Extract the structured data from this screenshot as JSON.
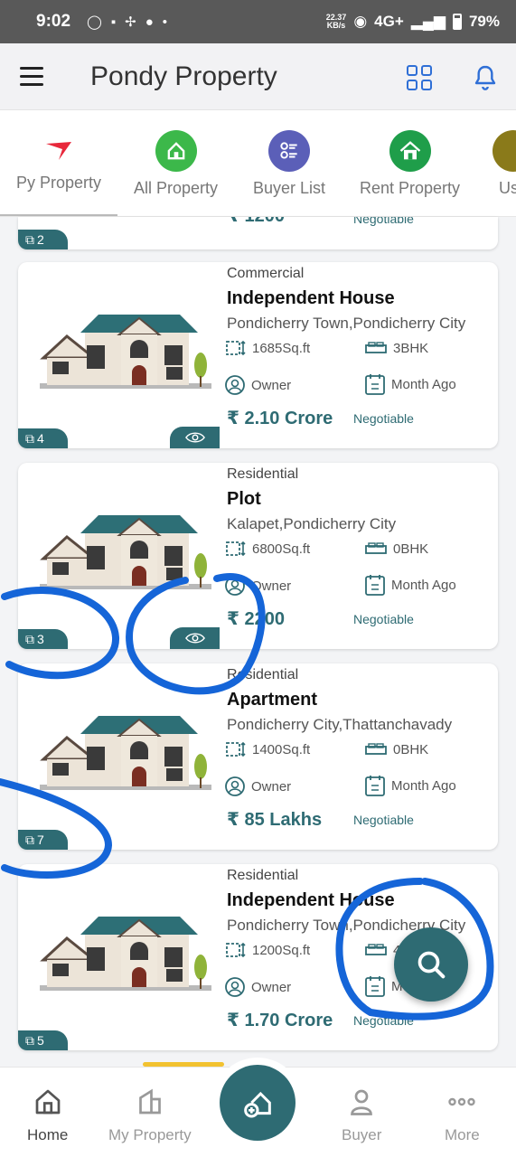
{
  "status_bar": {
    "time": "9:02",
    "speed_value": "22.37",
    "speed_unit": "KB/s",
    "network": "4G+",
    "battery": "79%"
  },
  "app_bar": {
    "title": "Pondy Property",
    "menu_icon": "hamburger-menu-icon",
    "grid_icon": "grid-icon",
    "bell_icon": "bell-icon",
    "accent": "#2f6fd6"
  },
  "categories": [
    {
      "label": "Py Property",
      "icon": "logo-icon",
      "active": true
    },
    {
      "label": "All Property",
      "icon": "house-hand-icon",
      "color": "#3cb84a"
    },
    {
      "label": "Buyer List",
      "icon": "list-icon",
      "color": "#5b5fb8"
    },
    {
      "label": "Rent Property",
      "icon": "house-icon",
      "color": "#1f9e4a"
    },
    {
      "label": "Use",
      "icon": "partial-icon",
      "color": "#8a7a1a"
    }
  ],
  "partial_card": {
    "price": "₹ 1200",
    "negotiable": "Negotiable",
    "photos": "2"
  },
  "listings": [
    {
      "type": "Commercial",
      "title": "Independent House",
      "location": "Pondicherry Town,Pondicherry City",
      "area": "1685Sq.ft",
      "bhk": "3BHK",
      "posted_by": "Owner",
      "posted": "Month Ago",
      "price": "₹ 2.10 Crore",
      "negotiable": "Negotiable",
      "photos": "4",
      "has_view": true
    },
    {
      "type": "Residential",
      "title": "Plot",
      "location": "Kalapet,Pondicherry City",
      "area": "6800Sq.ft",
      "bhk": "0BHK",
      "posted_by": "Owner",
      "posted": "Month Ago",
      "price": "₹ 2200",
      "negotiable": "Negotiable",
      "photos": "3",
      "has_view": true
    },
    {
      "type": "Residential",
      "title": "Apartment",
      "location": "Pondicherry City,Thattanchavady",
      "area": "1400Sq.ft",
      "bhk": "0BHK",
      "posted_by": "Owner",
      "posted": "Month Ago",
      "price": "₹ 85 Lakhs",
      "negotiable": "Negotiable",
      "photos": "7",
      "has_view": false
    },
    {
      "type": "Residential",
      "title": "Independent House",
      "location": "Pondicherry Town,Pondicherry City",
      "area": "1200Sq.ft",
      "bhk": "4BHK",
      "posted_by": "Owner",
      "posted": "Month Ago",
      "price": "₹ 1.70 Crore",
      "negotiable": "Negotiable",
      "photos": "5",
      "has_view": false
    }
  ],
  "bottom_nav": {
    "home": "Home",
    "my_property": "My Property",
    "buyer": "Buyer",
    "more": "More"
  },
  "colors": {
    "primary": "#2e6b73",
    "annotation": "#1565d8"
  }
}
